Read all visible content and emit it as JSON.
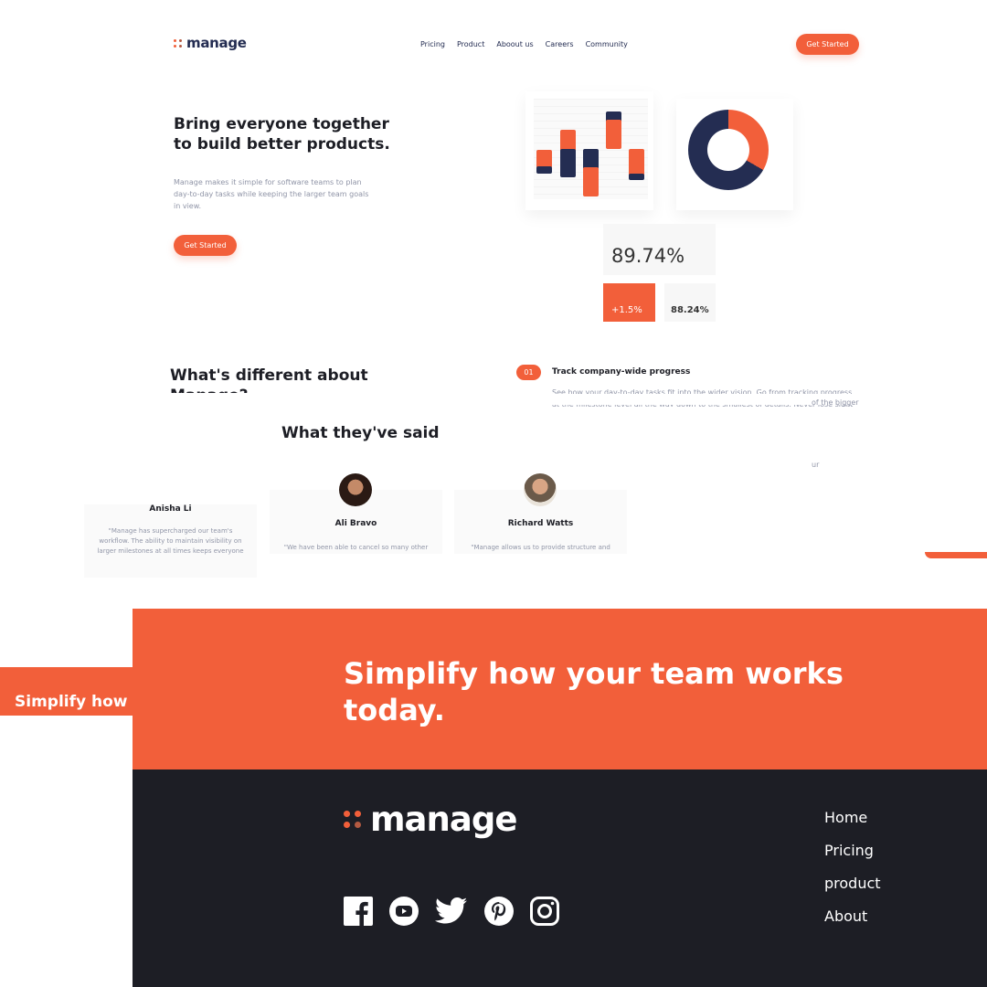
{
  "header": {
    "logo": "manage",
    "nav": [
      "Pricing",
      "Product",
      "Aboout us",
      "Careers",
      "Community"
    ],
    "cta": "Get Started"
  },
  "hero": {
    "title": "Bring everyone together to build better products.",
    "description": "Manage makes it simple for software teams to plan day-to-day tasks while keeping the larger team goals in view.",
    "cta": "Get Started",
    "stats": {
      "main": "89.74%",
      "change": "+1.5%",
      "secondary": "88.24%"
    },
    "bar_chart": {
      "series": [
        {
          "name": "orange",
          "color": "#f25f3a"
        },
        {
          "name": "navy",
          "color": "#242d52"
        }
      ]
    },
    "donut": {
      "orange_fraction": 0.33,
      "colors": [
        "#f25f3a",
        "#242d52"
      ]
    }
  },
  "features": {
    "title": "What's different about Manage?",
    "items": [
      {
        "number": "01",
        "title": "Track company-wide progress",
        "text": "See how your day-to-day tasks fit into the wider vision. Go from tracking progress at the milestone level all the way down to the smallest of details. Never lose sight of the bigger picture again."
      }
    ],
    "fragments": [
      "of the bigger",
      "ur"
    ]
  },
  "testimonials": {
    "title": "What they've said",
    "items": [
      {
        "name": "Anisha Li",
        "quote": "\"Manage has supercharged our team's workflow. The ability to maintain visibility on larger milestones at all times keeps everyone motivated.\""
      },
      {
        "name": "Ali Bravo",
        "quote": "\"We have been able to cancel so many other subscriptions since using Manage.\""
      },
      {
        "name": "Richard Watts",
        "quote": "\"Manage allows us to provide structure and process.\""
      }
    ]
  },
  "cta_band": {
    "title": "Simplify how your team works today.",
    "ghost_text": "Simplify how your team works today."
  },
  "footer": {
    "logo": "manage",
    "socials": [
      "facebook-icon",
      "youtube-icon",
      "twitter-icon",
      "pinterest-icon",
      "instagram-icon"
    ],
    "links": [
      "Home",
      "Pricing",
      "product",
      "About"
    ]
  },
  "colors": {
    "accent": "#f25f3a",
    "navy": "#242d52",
    "dark": "#1d1e25",
    "muted": "#9095a7"
  }
}
